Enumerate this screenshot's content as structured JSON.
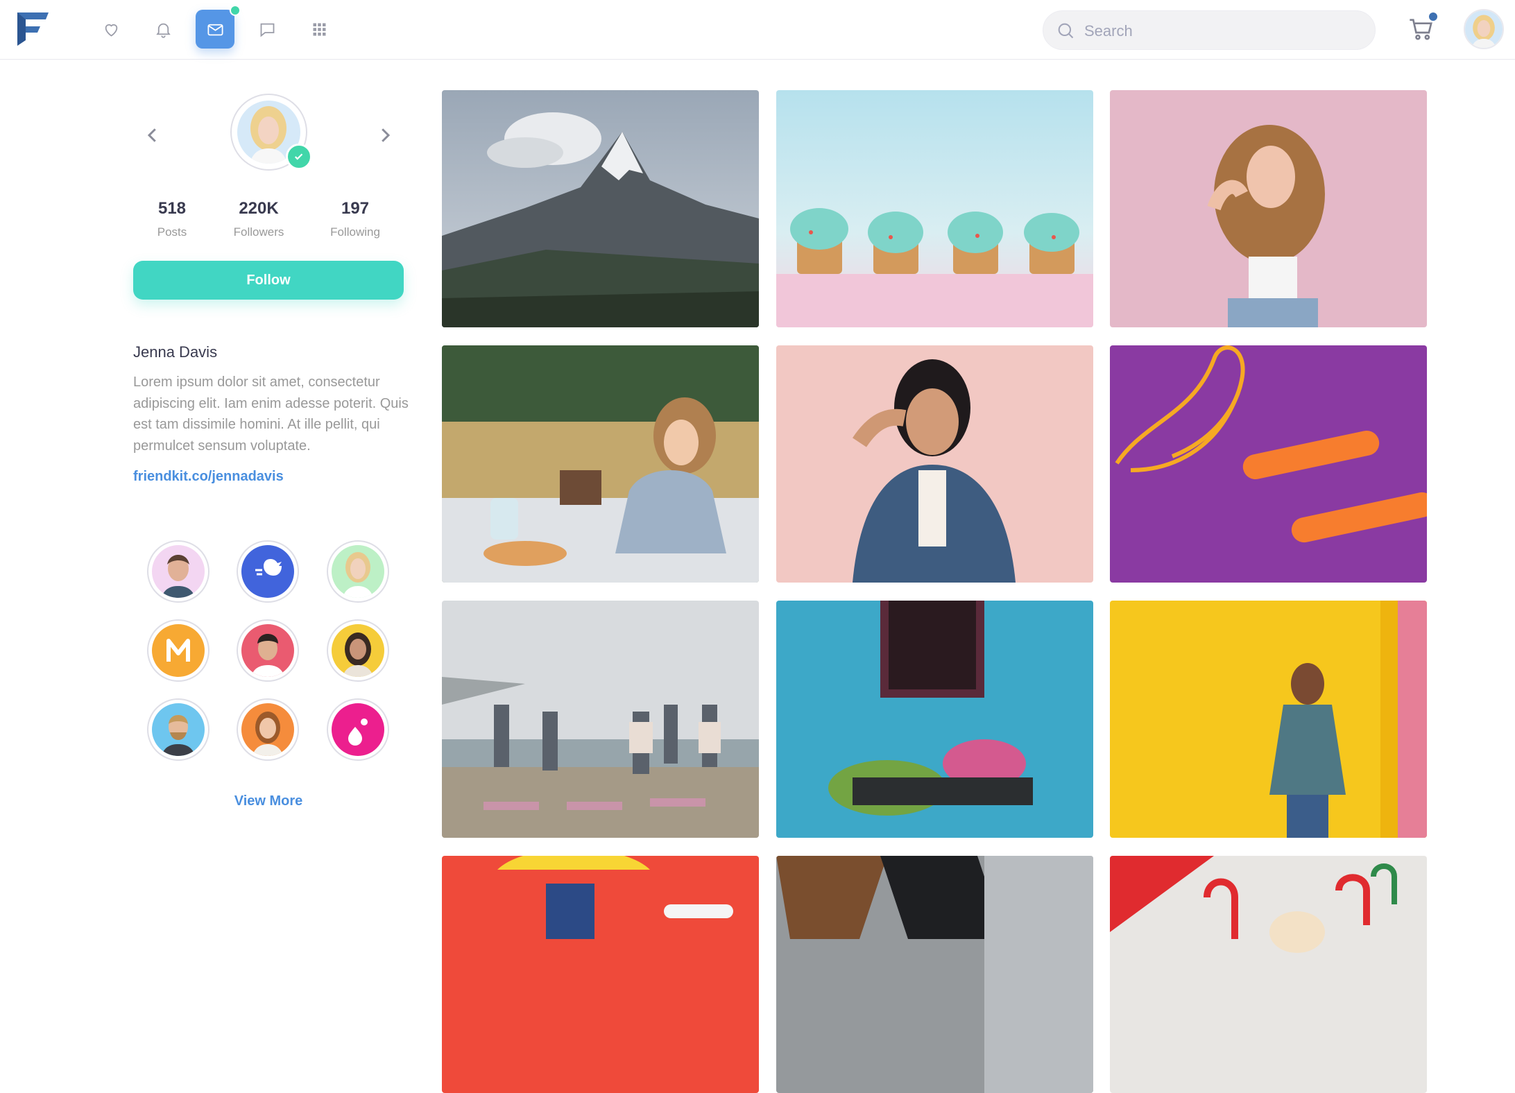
{
  "navbar": {
    "logo_icon": "friendkit-logo-icon",
    "icons": [
      "heart-icon",
      "bell-icon",
      "mail-icon",
      "chat-icon",
      "apps-grid-icon"
    ],
    "active_icon": "mail-icon",
    "search": {
      "placeholder": "Search"
    },
    "cart_icon": "cart-icon",
    "accent": "#5596e6"
  },
  "profile": {
    "stats": [
      {
        "value": "518",
        "label": "Posts"
      },
      {
        "value": "220K",
        "label": "Followers"
      },
      {
        "value": "197",
        "label": "Following"
      }
    ],
    "follow_label": "Follow",
    "name": "Jenna Davis",
    "bio": "Lorem ipsum dolor sit amet, consectetur adipiscing elit. Iam enim adesse poterit. Quis est tam dissimile homini. At ille pellit, qui permulcet sensum voluptate.",
    "link": "friendkit.co/jennadavis",
    "follow_color": "#41d6c3"
  },
  "friends": {
    "items": [
      "man-avatar",
      "brand-dove-logo",
      "woman-avatar",
      "brand-m-logo",
      "man-avatar",
      "woman-avatar",
      "man-avatar",
      "woman-avatar",
      "brand-drop-logo"
    ],
    "view_more_label": "View More"
  },
  "gallery": {
    "photos": [
      "mountain-peak",
      "cupcakes",
      "woman-curly-hair",
      "picnic-woman",
      "woman-denim-jacket",
      "jump-rope",
      "beach-yoga",
      "blue-wall-window-flowers",
      "man-yellow-wall",
      "yellow-umbrella",
      "boots",
      "candy-canes"
    ]
  }
}
